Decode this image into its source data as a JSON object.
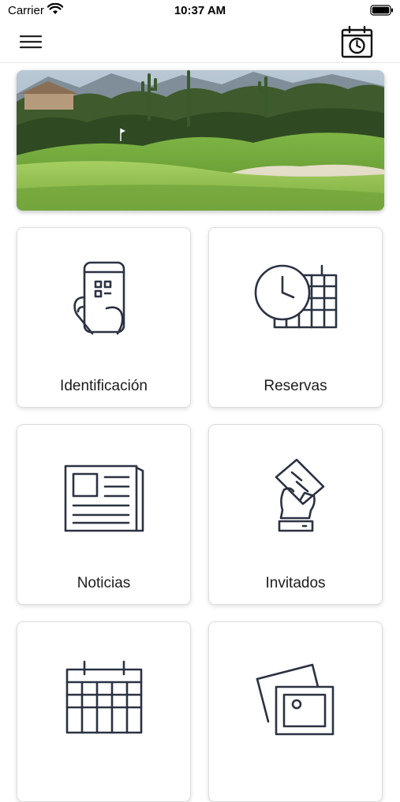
{
  "status_bar": {
    "carrier": "Carrier",
    "time": "10:37 AM"
  },
  "top_bar": {
    "menu_icon": "hamburger-menu-icon",
    "action_icon": "calendar-clock-icon"
  },
  "hero": {
    "image": "golf-course-photo",
    "description": ""
  },
  "tiles": [
    {
      "label": "Identificación",
      "icon": "phone-qr-icon"
    },
    {
      "label": "Reservas",
      "icon": "calendar-clock-icon"
    },
    {
      "label": "Noticias",
      "icon": "newspaper-icon"
    },
    {
      "label": "Invitados",
      "icon": "hand-ticket-icon"
    },
    {
      "label": "",
      "icon": "calendar-icon"
    },
    {
      "label": "",
      "icon": "photos-icon"
    }
  ],
  "colors": {
    "icon_stroke": "#2b3242",
    "background": "#ffffff",
    "grass": "#6fa23a",
    "sky": "#9ab3c9"
  }
}
